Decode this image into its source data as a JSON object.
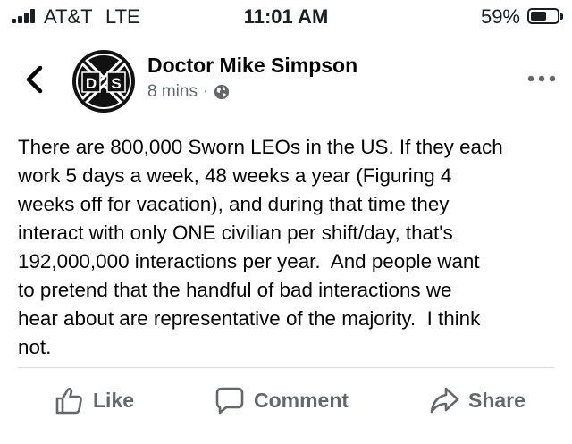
{
  "status_bar": {
    "carrier": "AT&T",
    "network": "LTE",
    "time": "11:01 AM",
    "battery_percent": "59%",
    "battery_level": 0.59
  },
  "post": {
    "author": "Doctor Mike Simpson",
    "avatar_icon": "ds-logo-avatar",
    "avatar_letters": [
      "D",
      "S"
    ],
    "time": "8 mins",
    "separator": "·",
    "privacy_icon": "globe-icon",
    "text": "There are 800,000 Sworn LEOs in the US. If they each\nwork 5 days a week, 48 weeks a year (Figuring 4\nweeks off for vacation), and during that time they\ninteract with only ONE civilian per shift/day, that's\n192,000,000 interactions per year.  And people want\nto pretend that the handful of bad interactions we\nhear about are representative of the majority.  I think\nnot."
  },
  "actions": {
    "like": "Like",
    "comment": "Comment",
    "share": "Share"
  }
}
